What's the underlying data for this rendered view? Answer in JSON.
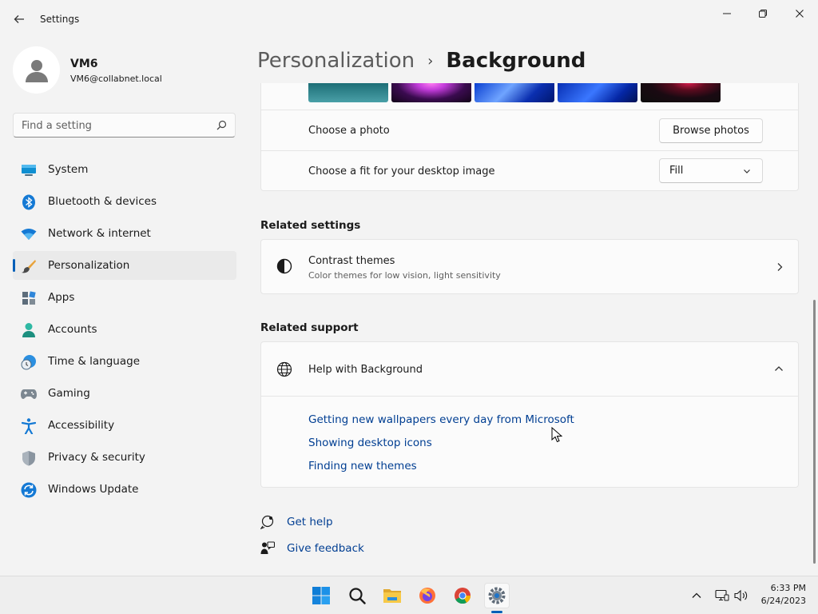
{
  "window": {
    "title": "Settings",
    "back_icon": "back-arrow-icon",
    "controls": [
      "minimize-icon",
      "maximize-icon",
      "close-icon"
    ]
  },
  "profile": {
    "name": "VM6",
    "email": "VM6@collabnet.local"
  },
  "search": {
    "placeholder": "Find a setting",
    "value": ""
  },
  "sidebar": {
    "items": [
      {
        "label": "System",
        "icon": "monitor-icon"
      },
      {
        "label": "Bluetooth & devices",
        "icon": "bluetooth-icon"
      },
      {
        "label": "Network & internet",
        "icon": "wifi-icon"
      },
      {
        "label": "Personalization",
        "icon": "paintbrush-icon",
        "active": true
      },
      {
        "label": "Apps",
        "icon": "apps-icon"
      },
      {
        "label": "Accounts",
        "icon": "person-icon"
      },
      {
        "label": "Time & language",
        "icon": "globe-clock-icon"
      },
      {
        "label": "Gaming",
        "icon": "gamepad-icon"
      },
      {
        "label": "Accessibility",
        "icon": "accessibility-icon"
      },
      {
        "label": "Privacy & security",
        "icon": "shield-icon"
      },
      {
        "label": "Windows Update",
        "icon": "update-icon"
      }
    ]
  },
  "breadcrumb": {
    "parent": "Personalization",
    "separator": "›",
    "current": "Background"
  },
  "background": {
    "choose_photo_label": "Choose a photo",
    "browse_button": "Browse photos",
    "fit_label": "Choose a fit for your desktop image",
    "fit_value": "Fill"
  },
  "related_settings": {
    "title": "Related settings",
    "contrast_title": "Contrast themes",
    "contrast_subtitle": "Color themes for low vision, light sensitivity"
  },
  "related_support": {
    "title": "Related support",
    "help_title": "Help with Background",
    "links": [
      "Getting new wallpapers every day from Microsoft",
      "Showing desktop icons",
      "Finding new themes"
    ]
  },
  "footer": {
    "get_help": "Get help",
    "give_feedback": "Give feedback"
  },
  "taskbar": {
    "apps": [
      "windows-start-icon",
      "search-icon",
      "file-explorer-icon",
      "firefox-icon",
      "chrome-icon",
      "settings-icon"
    ],
    "time": "6:33 PM",
    "date": "6/24/2023"
  },
  "colors": {
    "accent": "#005fb8",
    "link": "#003e92",
    "background": "#f3f3f3",
    "card": "#fbfbfb"
  }
}
